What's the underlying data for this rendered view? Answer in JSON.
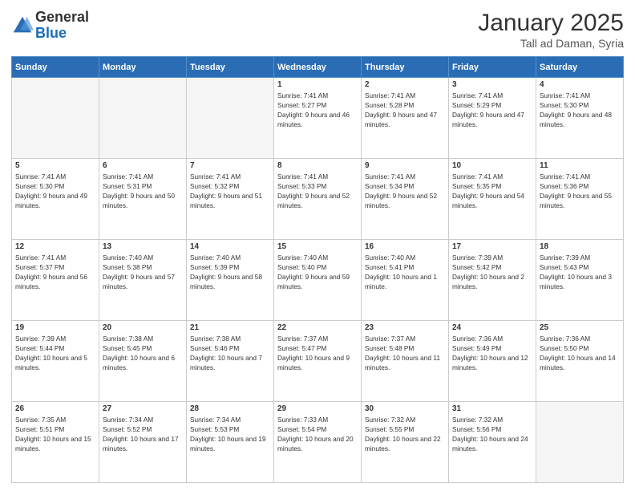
{
  "header": {
    "logo_general": "General",
    "logo_blue": "Blue",
    "title": "January 2025",
    "subtitle": "Tall ad Daman, Syria"
  },
  "days_of_week": [
    "Sunday",
    "Monday",
    "Tuesday",
    "Wednesday",
    "Thursday",
    "Friday",
    "Saturday"
  ],
  "weeks": [
    [
      {
        "day": "",
        "sunrise": "",
        "sunset": "",
        "daylight": ""
      },
      {
        "day": "",
        "sunrise": "",
        "sunset": "",
        "daylight": ""
      },
      {
        "day": "",
        "sunrise": "",
        "sunset": "",
        "daylight": ""
      },
      {
        "day": "1",
        "sunrise": "Sunrise: 7:41 AM",
        "sunset": "Sunset: 5:27 PM",
        "daylight": "Daylight: 9 hours and 46 minutes."
      },
      {
        "day": "2",
        "sunrise": "Sunrise: 7:41 AM",
        "sunset": "Sunset: 5:28 PM",
        "daylight": "Daylight: 9 hours and 47 minutes."
      },
      {
        "day": "3",
        "sunrise": "Sunrise: 7:41 AM",
        "sunset": "Sunset: 5:29 PM",
        "daylight": "Daylight: 9 hours and 47 minutes."
      },
      {
        "day": "4",
        "sunrise": "Sunrise: 7:41 AM",
        "sunset": "Sunset: 5:30 PM",
        "daylight": "Daylight: 9 hours and 48 minutes."
      }
    ],
    [
      {
        "day": "5",
        "sunrise": "Sunrise: 7:41 AM",
        "sunset": "Sunset: 5:30 PM",
        "daylight": "Daylight: 9 hours and 49 minutes."
      },
      {
        "day": "6",
        "sunrise": "Sunrise: 7:41 AM",
        "sunset": "Sunset: 5:31 PM",
        "daylight": "Daylight: 9 hours and 50 minutes."
      },
      {
        "day": "7",
        "sunrise": "Sunrise: 7:41 AM",
        "sunset": "Sunset: 5:32 PM",
        "daylight": "Daylight: 9 hours and 51 minutes."
      },
      {
        "day": "8",
        "sunrise": "Sunrise: 7:41 AM",
        "sunset": "Sunset: 5:33 PM",
        "daylight": "Daylight: 9 hours and 52 minutes."
      },
      {
        "day": "9",
        "sunrise": "Sunrise: 7:41 AM",
        "sunset": "Sunset: 5:34 PM",
        "daylight": "Daylight: 9 hours and 52 minutes."
      },
      {
        "day": "10",
        "sunrise": "Sunrise: 7:41 AM",
        "sunset": "Sunset: 5:35 PM",
        "daylight": "Daylight: 9 hours and 54 minutes."
      },
      {
        "day": "11",
        "sunrise": "Sunrise: 7:41 AM",
        "sunset": "Sunset: 5:36 PM",
        "daylight": "Daylight: 9 hours and 55 minutes."
      }
    ],
    [
      {
        "day": "12",
        "sunrise": "Sunrise: 7:41 AM",
        "sunset": "Sunset: 5:37 PM",
        "daylight": "Daylight: 9 hours and 56 minutes."
      },
      {
        "day": "13",
        "sunrise": "Sunrise: 7:40 AM",
        "sunset": "Sunset: 5:38 PM",
        "daylight": "Daylight: 9 hours and 57 minutes."
      },
      {
        "day": "14",
        "sunrise": "Sunrise: 7:40 AM",
        "sunset": "Sunset: 5:39 PM",
        "daylight": "Daylight: 9 hours and 58 minutes."
      },
      {
        "day": "15",
        "sunrise": "Sunrise: 7:40 AM",
        "sunset": "Sunset: 5:40 PM",
        "daylight": "Daylight: 9 hours and 59 minutes."
      },
      {
        "day": "16",
        "sunrise": "Sunrise: 7:40 AM",
        "sunset": "Sunset: 5:41 PM",
        "daylight": "Daylight: 10 hours and 1 minute."
      },
      {
        "day": "17",
        "sunrise": "Sunrise: 7:39 AM",
        "sunset": "Sunset: 5:42 PM",
        "daylight": "Daylight: 10 hours and 2 minutes."
      },
      {
        "day": "18",
        "sunrise": "Sunrise: 7:39 AM",
        "sunset": "Sunset: 5:43 PM",
        "daylight": "Daylight: 10 hours and 3 minutes."
      }
    ],
    [
      {
        "day": "19",
        "sunrise": "Sunrise: 7:39 AM",
        "sunset": "Sunset: 5:44 PM",
        "daylight": "Daylight: 10 hours and 5 minutes."
      },
      {
        "day": "20",
        "sunrise": "Sunrise: 7:38 AM",
        "sunset": "Sunset: 5:45 PM",
        "daylight": "Daylight: 10 hours and 6 minutes."
      },
      {
        "day": "21",
        "sunrise": "Sunrise: 7:38 AM",
        "sunset": "Sunset: 5:46 PM",
        "daylight": "Daylight: 10 hours and 7 minutes."
      },
      {
        "day": "22",
        "sunrise": "Sunrise: 7:37 AM",
        "sunset": "Sunset: 5:47 PM",
        "daylight": "Daylight: 10 hours and 9 minutes."
      },
      {
        "day": "23",
        "sunrise": "Sunrise: 7:37 AM",
        "sunset": "Sunset: 5:48 PM",
        "daylight": "Daylight: 10 hours and 11 minutes."
      },
      {
        "day": "24",
        "sunrise": "Sunrise: 7:36 AM",
        "sunset": "Sunset: 5:49 PM",
        "daylight": "Daylight: 10 hours and 12 minutes."
      },
      {
        "day": "25",
        "sunrise": "Sunrise: 7:36 AM",
        "sunset": "Sunset: 5:50 PM",
        "daylight": "Daylight: 10 hours and 14 minutes."
      }
    ],
    [
      {
        "day": "26",
        "sunrise": "Sunrise: 7:35 AM",
        "sunset": "Sunset: 5:51 PM",
        "daylight": "Daylight: 10 hours and 15 minutes."
      },
      {
        "day": "27",
        "sunrise": "Sunrise: 7:34 AM",
        "sunset": "Sunset: 5:52 PM",
        "daylight": "Daylight: 10 hours and 17 minutes."
      },
      {
        "day": "28",
        "sunrise": "Sunrise: 7:34 AM",
        "sunset": "Sunset: 5:53 PM",
        "daylight": "Daylight: 10 hours and 19 minutes."
      },
      {
        "day": "29",
        "sunrise": "Sunrise: 7:33 AM",
        "sunset": "Sunset: 5:54 PM",
        "daylight": "Daylight: 10 hours and 20 minutes."
      },
      {
        "day": "30",
        "sunrise": "Sunrise: 7:32 AM",
        "sunset": "Sunset: 5:55 PM",
        "daylight": "Daylight: 10 hours and 22 minutes."
      },
      {
        "day": "31",
        "sunrise": "Sunrise: 7:32 AM",
        "sunset": "Sunset: 5:56 PM",
        "daylight": "Daylight: 10 hours and 24 minutes."
      },
      {
        "day": "",
        "sunrise": "",
        "sunset": "",
        "daylight": ""
      }
    ]
  ]
}
